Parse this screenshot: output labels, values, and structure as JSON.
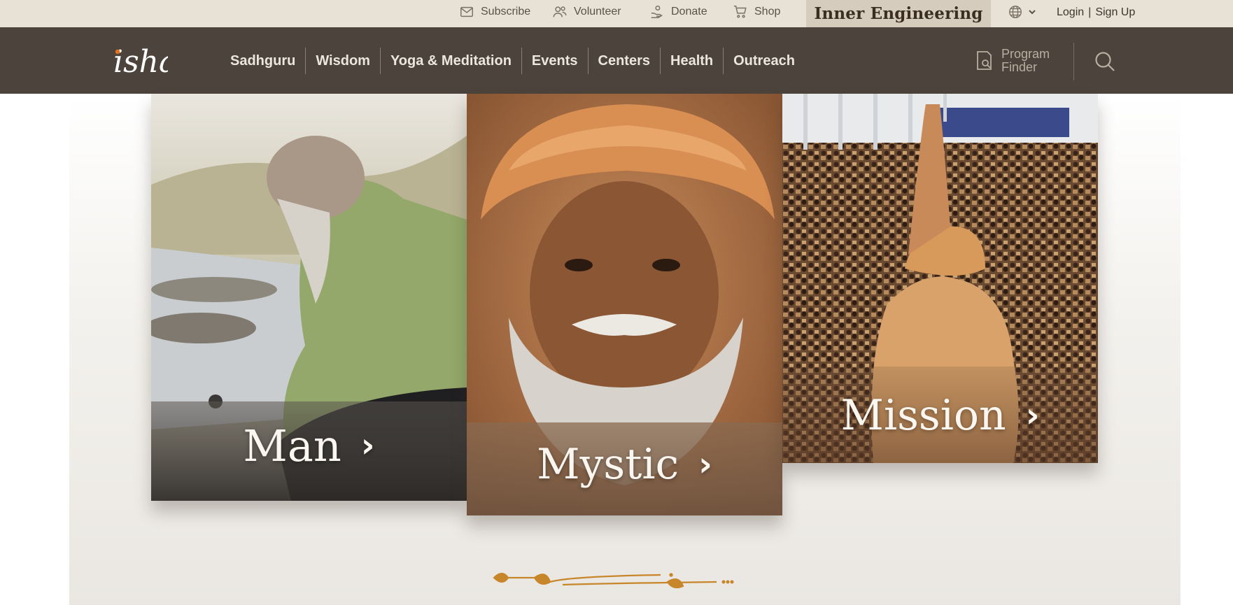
{
  "topbar": {
    "subscribe": "Subscribe",
    "volunteer": "Volunteer",
    "donate": "Donate",
    "shop": "Shop",
    "inner_engineering": "Inner Engineering",
    "login": "Login",
    "separator": "|",
    "signup": "Sign Up"
  },
  "nav": {
    "logo_text": "isha",
    "items": [
      "Sadhguru",
      "Wisdom",
      "Yoga & Meditation",
      "Events",
      "Centers",
      "Health",
      "Outreach"
    ],
    "program_finder_line1": "Program",
    "program_finder_line2": "Finder"
  },
  "cards": {
    "man": {
      "label": "Man",
      "chevron": "›"
    },
    "mystic": {
      "label": "Mystic",
      "chevron": "›"
    },
    "mission": {
      "label": "Mission",
      "chevron": "›"
    }
  },
  "colors": {
    "topbar_bg": "#e8e2d6",
    "nav_bg": "#4b433c",
    "accent_orange": "#e8701a",
    "flourish_gold": "#c8862a"
  },
  "icons": [
    "envelope-icon",
    "people-icon",
    "donate-hand-icon",
    "cart-icon",
    "globe-icon",
    "chevron-down-icon",
    "program-finder-icon",
    "search-icon",
    "chevron-right-icon"
  ]
}
